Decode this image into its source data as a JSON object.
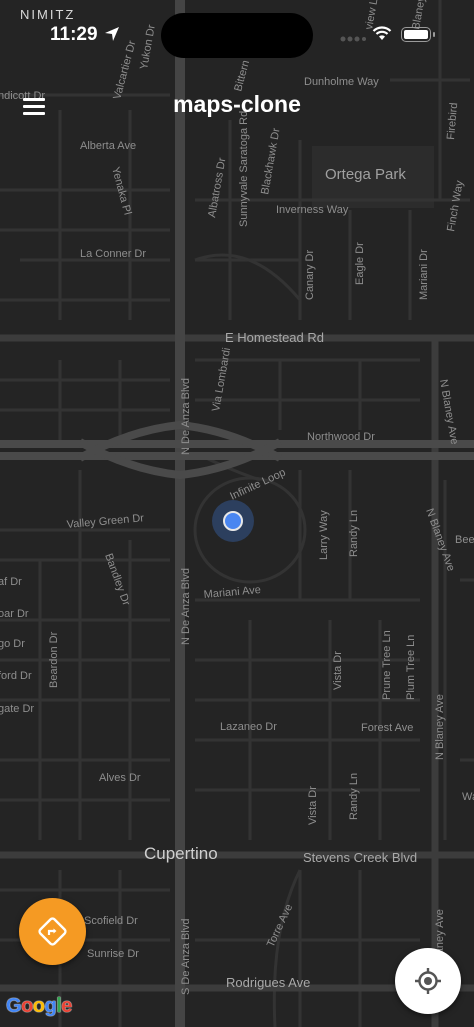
{
  "status_bar": {
    "carrier": "NIMITZ",
    "time": "11:29"
  },
  "header": {
    "title": "maps-clone"
  },
  "map": {
    "city_label": "Cupertino",
    "park_label": "Ortega Park",
    "road_labels": {
      "dunholme": "Dunholme Way",
      "alberta": "Alberta Ave",
      "la_conner": "La Conner Dr",
      "inverness": "Inverness Way",
      "homestead": "E Homestead Rd",
      "northwood": "Northwood Dr",
      "valley_green": "Valley Green Dr",
      "mariani_ave": "Mariani Ave",
      "lazaneo": "Lazaneo Dr",
      "forest": "Forest Ave",
      "alves": "Alves Dr",
      "stevens_creek": "Stevens Creek Blvd",
      "scofield": "Scofield Dr",
      "sunrise": "Sunrise Dr",
      "rodrigues": "Rodrigues Ave",
      "saratoga": "Sunnyvale Saratoga Rd",
      "de_anza_n1": "N De Anza Blvd",
      "de_anza_n2": "N De Anza Blvd",
      "de_anza_n3": "N De Anza Blvd",
      "de_anza_s": "S De Anza Blvd",
      "blaney_1": "N Blaney Ave",
      "blaney_2": "N Blaney Ave",
      "blaney_3": "N Blaney Ave",
      "blaney_4": "N Blaney Ave",
      "blaney_s": "Blaney Ave",
      "vista": "Vista Dr",
      "vista_2": "Vista Dr",
      "larry": "Larry Way",
      "randy": "Randy Ln",
      "randy_2": "Randy Ln",
      "prune_tree": "Prune Tree Ln",
      "plum_tree": "Plum Tree Ln",
      "torre": "Torre Ave",
      "bandley": "Bandley Dr",
      "beardon": "Beardon Dr",
      "via_lombardi": "Via Lombardi",
      "albatross": "Albatross Dr",
      "blackhawk": "Blackhawk Dr",
      "canary": "Canary Dr",
      "eagle": "Eagle Dr",
      "mariani_dr": "Mariani Dr",
      "finch": "Finch Way",
      "firebird": "Firebird",
      "yukon": "Yukon Dr",
      "valcartier": "Valcartier Dr",
      "yenaka": "Yenaka Pl",
      "bittern": "Bittern",
      "infinite": "Infinite Loop",
      "cut_lindicott": "ndicott Dr",
      "cut_af": "af Dr",
      "cut_oar": "oar Dr",
      "cut_go": "go Dr",
      "cut_ford": "ford Dr",
      "cut_gate": "gate Dr",
      "cut_bee": "Bee",
      "cut_wa": "Wa",
      "cut_view": "view Ln"
    }
  },
  "controls": {
    "directions_icon": "directions-icon",
    "locate_icon": "my-location-icon",
    "menu_icon": "hamburger-menu-icon"
  },
  "branding": {
    "logo_letters": [
      "G",
      "o",
      "o",
      "g",
      "l",
      "e"
    ],
    "logo_colors": [
      "#4285F4",
      "#EA4335",
      "#FBBC05",
      "#4285F4",
      "#34A853",
      "#EA4335"
    ]
  },
  "colors": {
    "map_background": "#242424",
    "road": "#3a3a3a",
    "highway": "#4a4a4a",
    "accent_fab": "#f59a23",
    "user_location": "#4a86f0"
  }
}
